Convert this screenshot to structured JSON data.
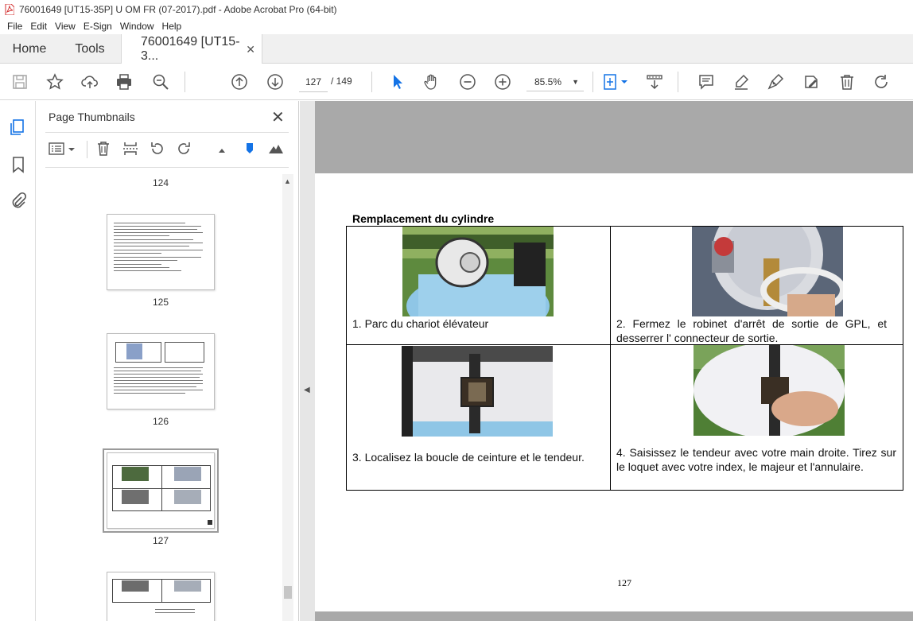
{
  "window": {
    "title": "76001649 [UT15-35P] U OM FR (07-2017).pdf - Adobe Acrobat Pro (64-bit)"
  },
  "menu": [
    "File",
    "Edit",
    "View",
    "E-Sign",
    "Window",
    "Help"
  ],
  "tabs": {
    "home": "Home",
    "tools": "Tools",
    "document": "76001649 [UT15-3..."
  },
  "toolbar": {
    "current_page": "127",
    "total_pages": "/ 149",
    "zoom": "85.5%"
  },
  "panel": {
    "title": "Page Thumbnails",
    "thumbnails": [
      {
        "label": "124"
      },
      {
        "label": "125"
      },
      {
        "label": "126"
      },
      {
        "label": "127"
      }
    ]
  },
  "document": {
    "heading": "Remplacement du cylindre",
    "steps": [
      {
        "text": "1. Parc du chariot élévateur"
      },
      {
        "text": "2. Fermez le robinet d'arrêt de sortie de GPL, et desserrer l' connecteur de sortie."
      },
      {
        "text": "3. Localisez la boucle de ceinture et le tendeur."
      },
      {
        "text": "4. Saisissez le tendeur avec votre main droite. Tirez sur le loquet avec votre index, le majeur et l'annulaire."
      }
    ],
    "page_number": "127"
  },
  "colors": {
    "accent": "#1473e6",
    "pdf_red": "#d32f2f",
    "gray_band": "#a9a9a9"
  }
}
